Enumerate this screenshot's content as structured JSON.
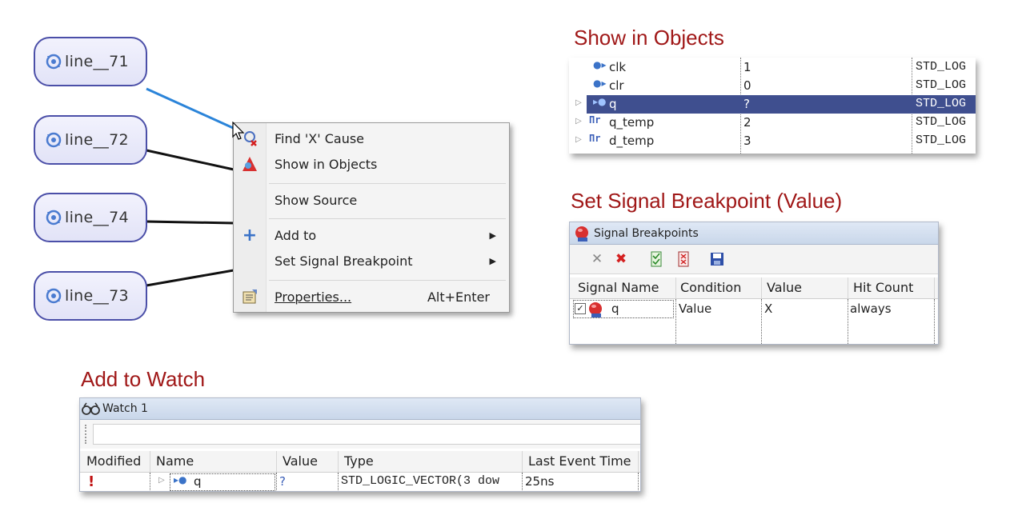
{
  "headings": {
    "show_in_objects": "Show in Objects",
    "set_signal_breakpoint": "Set Signal Breakpoint (Value)",
    "add_to_watch": "Add to Watch"
  },
  "nodes": [
    {
      "label": "line__71"
    },
    {
      "label": "line__72"
    },
    {
      "label": "line__74"
    },
    {
      "label": "line__73"
    }
  ],
  "context_menu": {
    "items": [
      {
        "label": "Find 'X' Cause",
        "icon": "find-x-cause-icon"
      },
      {
        "label": "Show in Objects",
        "icon": "show-in-objects-icon"
      },
      {
        "label": "Show Source"
      },
      {
        "label": "Add to",
        "icon": "plus-icon",
        "submenu": true
      },
      {
        "label": "Set Signal Breakpoint",
        "submenu": true
      },
      {
        "label": "Properties...",
        "icon": "properties-icon",
        "shortcut": "Alt+Enter"
      }
    ]
  },
  "objects": {
    "rows": [
      {
        "name": "clk",
        "value": "1",
        "type": "STD_LOG",
        "icon": "input-port-icon",
        "expandable": false,
        "selected": false
      },
      {
        "name": "clr",
        "value": "0",
        "type": "STD_LOG",
        "icon": "input-port-icon",
        "expandable": false,
        "selected": false
      },
      {
        "name": "q",
        "value": "?",
        "type": "STD_LOG",
        "icon": "output-port-icon",
        "expandable": true,
        "selected": true
      },
      {
        "name": "q_temp",
        "value": "2",
        "type": "STD_LOG",
        "icon": "signal-wave-icon",
        "expandable": true,
        "selected": false
      },
      {
        "name": "d_temp",
        "value": "3",
        "type": "STD_LOG",
        "icon": "signal-wave-icon",
        "expandable": true,
        "selected": false
      }
    ],
    "selection_color": "#3f4f8f"
  },
  "breakpoints": {
    "title": "Signal Breakpoints",
    "columns": [
      "Signal Name",
      "Condition",
      "Value",
      "Hit Count"
    ],
    "rows": [
      {
        "signal": "q",
        "condition": "Value",
        "value": "X",
        "hit_count": "always",
        "checked": true
      }
    ]
  },
  "watch": {
    "title": "Watch 1",
    "columns": [
      "Modified",
      "Name",
      "Value",
      "Type",
      "Last Event Time"
    ],
    "rows": [
      {
        "modified": "!",
        "name": "q",
        "value": "?",
        "type": "STD_LOGIC_VECTOR(3 dow",
        "last_event_time": "25ns"
      }
    ]
  },
  "colors": {
    "heading": "#a01818",
    "node_border": "#4b4fa8",
    "selected_edge": "#2b84d9"
  }
}
